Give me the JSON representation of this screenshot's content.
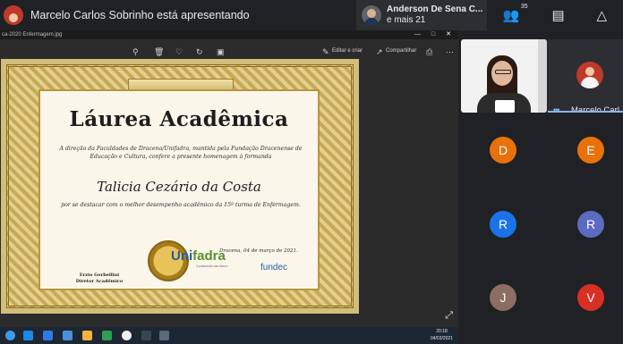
{
  "topbar": {
    "presenting_text": "Marcelo Carlos Sobrinho está apresentando",
    "pinned_name": "Anderson De Sena C...",
    "pinned_more": "e mais 21",
    "participants_count": "35",
    "icons": [
      "people-icon",
      "chat-icon",
      "activities-icon"
    ]
  },
  "window": {
    "filename": "ca-2020 Enfermagem.jpg",
    "toolbar": {
      "edit_label": "Editar e criar",
      "share_label": "Compartilhar"
    }
  },
  "certificate": {
    "title": "Láurea Acadêmica",
    "body": "A direção da Faculdades de Dracena/Unifadra, mantida pela Fundação Dracenense de Educação e Cultura, confere a presente homenagem à formanda",
    "name": "Talicia Cezário da Costa",
    "motivo": "por se destacar com o melhor desempenho acadêmico da 15ª turma de Enfermagem.",
    "date": "Dracena, 04 de março de 2021.",
    "signer_name": "Erzio Gerbellini",
    "signer_role": "Diretor Acadêmico",
    "logo_uni": "Uni",
    "logo_fadra": "fadra",
    "logo_sub": "Construindo seu futuro",
    "logo_fundec": "fundec"
  },
  "taskbar": {
    "time": "20:18",
    "date": "04/03/2021"
  },
  "participants": {
    "presenter_label": "Marcelo Carl...",
    "tiles": [
      {
        "letter": "D",
        "color": "#e8710a"
      },
      {
        "letter": "E",
        "color": "#e8710a"
      },
      {
        "letter": "R",
        "color": "#1a73e8"
      },
      {
        "letter": "R",
        "color": "#5c6bc0"
      },
      {
        "letter": "J",
        "color": "#8d6e63"
      },
      {
        "letter": "V",
        "color": "#d93025"
      }
    ]
  }
}
